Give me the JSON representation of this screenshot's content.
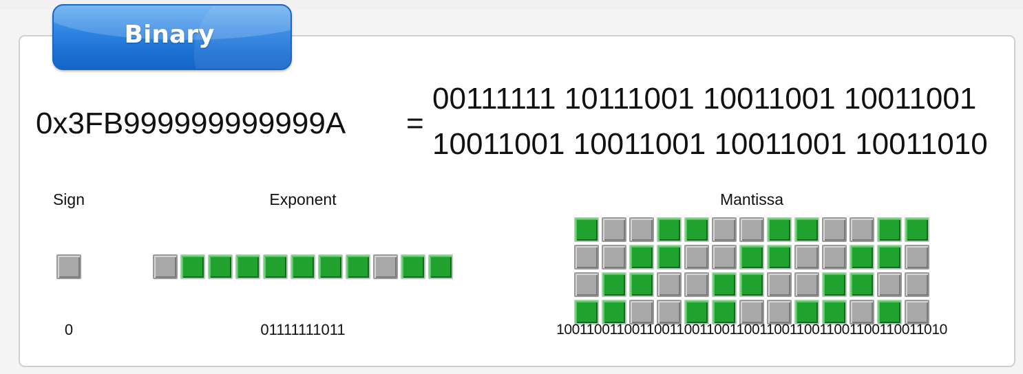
{
  "tab": {
    "label": "Binary"
  },
  "hex_value": "0x3FB999999999999A",
  "equals_sign": "=",
  "binary_lines": [
    "00111111 10111001 10011001 10011001",
    "10011001 10011001 10011001 10011010"
  ],
  "sign": {
    "label": "Sign",
    "value": "0"
  },
  "exponent": {
    "label": "Exponent",
    "value": "01111111011"
  },
  "mantissa": {
    "label": "Mantissa",
    "value": "1001100110011001100110011001100110011001100110011010"
  },
  "colors": {
    "bit_on": "#20a22e",
    "bit_off": "#a8a8a8",
    "tab_blue": "#1d72d6"
  }
}
